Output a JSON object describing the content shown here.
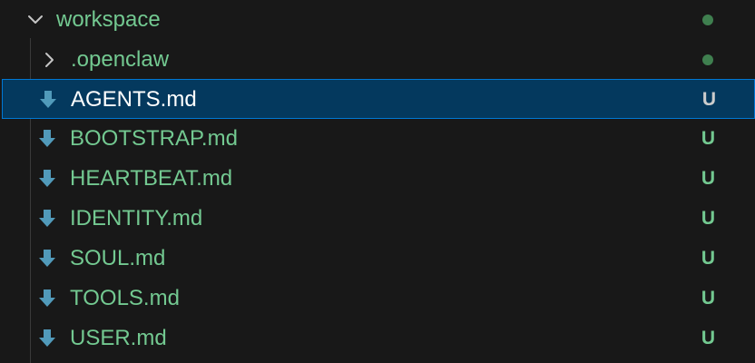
{
  "explorer": {
    "folder": {
      "label": "workspace",
      "expanded": true,
      "chevron_icon": "chevron-down-icon"
    },
    "subfolder": {
      "label": ".openclaw",
      "expanded": false,
      "chevron_icon": "chevron-right-icon"
    },
    "files": [
      {
        "label": "AGENTS.md",
        "status": "U",
        "selected": true,
        "icon": "markdown-download-icon"
      },
      {
        "label": "BOOTSTRAP.md",
        "status": "U",
        "selected": false,
        "icon": "markdown-download-icon"
      },
      {
        "label": "HEARTBEAT.md",
        "status": "U",
        "selected": false,
        "icon": "markdown-download-icon"
      },
      {
        "label": "IDENTITY.md",
        "status": "U",
        "selected": false,
        "icon": "markdown-download-icon"
      },
      {
        "label": "SOUL.md",
        "status": "U",
        "selected": false,
        "icon": "markdown-download-icon"
      },
      {
        "label": "TOOLS.md",
        "status": "U",
        "selected": false,
        "icon": "markdown-download-icon"
      },
      {
        "label": "USER.md",
        "status": "U",
        "selected": false,
        "icon": "markdown-download-icon"
      }
    ]
  },
  "colors": {
    "background": "#181818",
    "untracked_text": "#73c991",
    "selected_background": "#04395e",
    "selected_border": "#0078d4",
    "file_icon": "#519aba"
  }
}
